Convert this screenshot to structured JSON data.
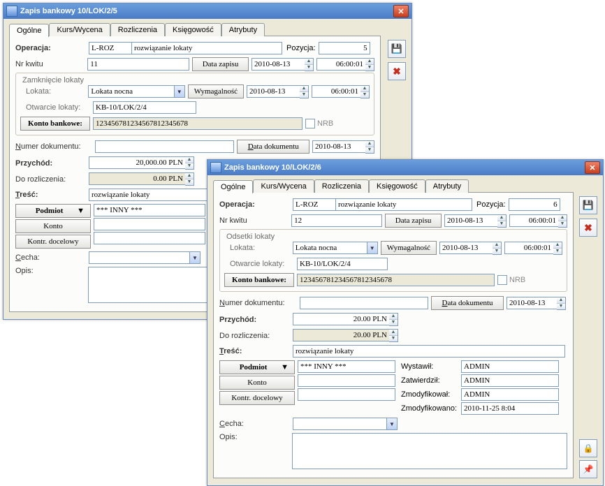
{
  "tabs": [
    "Ogólne",
    "Kurs/Wycena",
    "Rozliczenia",
    "Księgowość",
    "Atrybuty"
  ],
  "labels": {
    "operacja": "Operacja:",
    "pozycja": "Pozycja:",
    "nrKwitu": "Nr kwitu",
    "dataZapisu": "Data zapisu",
    "lokata": "Lokata:",
    "wymagalnosc": "Wymagalność",
    "otwarcie": "Otwarcie lokaty:",
    "kontoBankowe": "Konto bankowe:",
    "nrb": "NRB",
    "numerDokumentu": "Numer dokumentu:",
    "dataDokumentu": "Data dokumentu",
    "przychod": "Przychód:",
    "doRozliczenia": "Do rozliczenia:",
    "tresc": "Treść:",
    "podmiot": "Podmiot",
    "konto": "Konto",
    "kontrDocelowy": "Kontr. docelowy",
    "cecha": "Cecha:",
    "opis": "Opis:",
    "wystawil": "Wystawił:",
    "zatwierdzil": "Zatwierdził:",
    "zmodyfikowal": "Zmodyfikował:",
    "zmodyfikowano": "Zmodyfikowano:"
  },
  "win1": {
    "title": "Zapis bankowy 10/LOK/2/5",
    "operacjaCode": "L-ROZ",
    "operacjaDesc": "rozwiązanie lokaty",
    "pozycja": "5",
    "nrKwitu": "11",
    "dataZapisu": "2010-08-13",
    "czasZapisu": "06:00:01",
    "grpTitle": "Zamknięcie lokaty",
    "lokata": "Lokata nocna",
    "wymagalnoscDate": "2010-08-13",
    "wymagalnoscTime": "06:00:01",
    "otwarcie": "KB-10/LOK/2/4",
    "kontoBankowe": "123456781234567812345678",
    "numerDokumentu": "",
    "dataDokumentu": "2010-08-13",
    "przychod": "20,000.00 PLN",
    "doRozliczenia": "0.00 PLN",
    "tresc": "rozwiązanie lokaty",
    "podmiotVal": "*** INNY ***",
    "konto": "",
    "kontrDocelowy": "",
    "cecha": "",
    "opis": ""
  },
  "win2": {
    "title": "Zapis bankowy 10/LOK/2/6",
    "operacjaCode": "L-ROZ",
    "operacjaDesc": "rozwiązanie lokaty",
    "pozycja": "6",
    "nrKwitu": "12",
    "dataZapisu": "2010-08-13",
    "czasZapisu": "06:00:01",
    "grpTitle": "Odsetki lokaty",
    "lokata": "Lokata nocna",
    "wymagalnoscDate": "2010-08-13",
    "wymagalnoscTime": "06:00:01",
    "otwarcie": "KB-10/LOK/2/4",
    "kontoBankowe": "123456781234567812345678",
    "numerDokumentu": "",
    "dataDokumentu": "2010-08-13",
    "przychod": "20.00 PLN",
    "doRozliczenia": "20.00 PLN",
    "tresc": "rozwiązanie lokaty",
    "podmiotVal": "*** INNY ***",
    "konto": "",
    "kontrDocelowy": "",
    "cecha": "",
    "opis": "",
    "wystawil": "ADMIN",
    "zatwierdzil": "ADMIN",
    "zmodyfikowal": "ADMIN",
    "zmodyfikowano": "2010-11-25 8:04"
  }
}
